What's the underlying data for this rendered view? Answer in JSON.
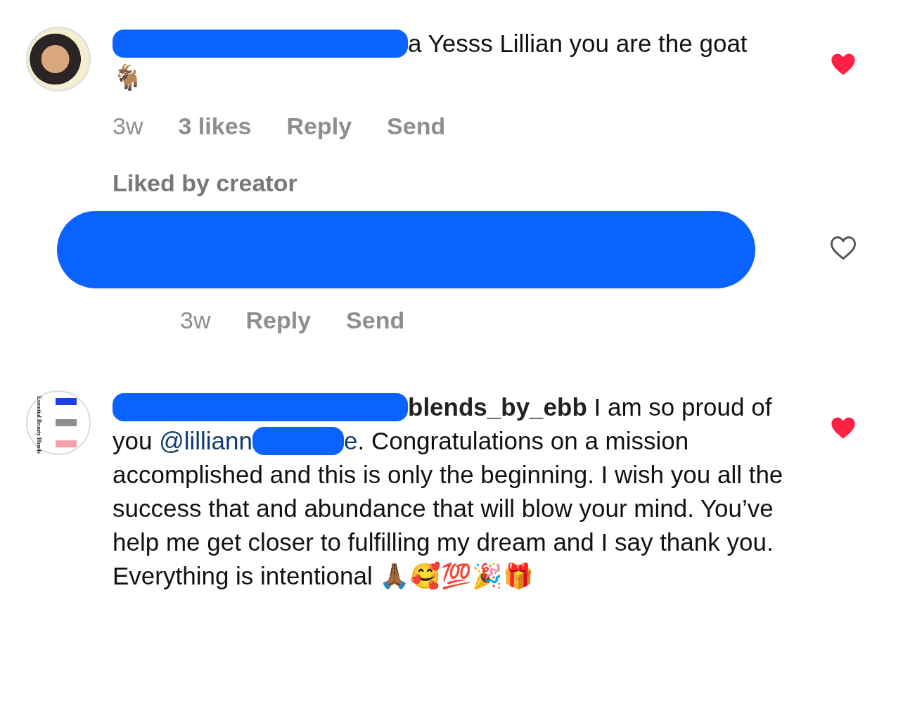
{
  "comments": [
    {
      "kind": "comment",
      "avatar": {
        "kind": "photo"
      },
      "liked": true,
      "body": [
        {
          "kind": "redaction"
        },
        {
          "kind": "text",
          "text": "a Yesss Lillian you are the goat 🐐"
        }
      ],
      "meta": [
        {
          "kind": "time",
          "text": "3w"
        },
        {
          "kind": "action",
          "text": "3 likes"
        },
        {
          "kind": "action",
          "text": "Reply"
        },
        {
          "kind": "action",
          "text": "Send"
        }
      ],
      "note": "Liked by creator"
    },
    {
      "kind": "reply",
      "avatar": {
        "kind": "hidden"
      },
      "liked": false,
      "body": [
        {
          "kind": "redaction"
        }
      ],
      "meta": [
        {
          "kind": "time",
          "text": "3w"
        },
        {
          "kind": "action",
          "text": "Reply"
        },
        {
          "kind": "action",
          "text": "Send"
        }
      ]
    },
    {
      "kind": "comment",
      "avatar": {
        "kind": "logo",
        "text": "Essential Beauty Blends"
      },
      "liked": true,
      "body": [
        {
          "kind": "redaction"
        },
        {
          "kind": "username",
          "text": "blends_by_ebb"
        },
        {
          "kind": "text",
          "text": " I am so proud of you "
        },
        {
          "kind": "mention",
          "text": "@lilliann"
        },
        {
          "kind": "redaction"
        },
        {
          "kind": "mention",
          "text": "e"
        },
        {
          "kind": "text",
          "text": ". Congratulations on a mission accomplished and this is only the beginning. I wish you all the success that and abundance that will blow your mind. You’ve help me get closer to fulfilling my dream and I say thank you. Everything is intentional 🙏🏾🥰💯🎉🎁"
        }
      ]
    }
  ]
}
